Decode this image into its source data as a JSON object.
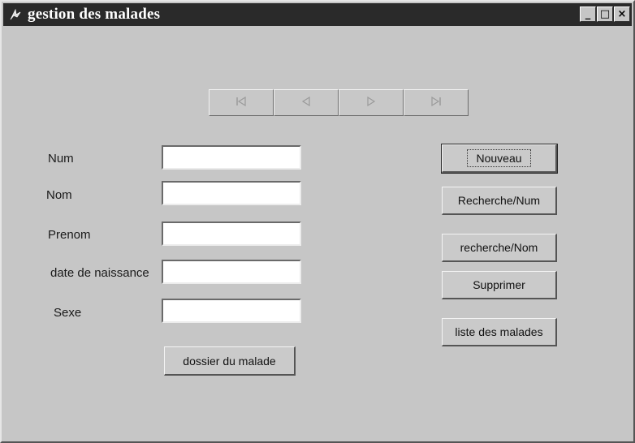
{
  "window": {
    "title": "gestion des malades",
    "minimize_glyph": "_",
    "maximize_glyph": "□",
    "close_glyph": "×"
  },
  "navigation": {
    "first_icon": "first-record-icon",
    "prev_icon": "previous-record-icon",
    "next_icon": "next-record-icon",
    "last_icon": "last-record-icon"
  },
  "form": {
    "num_label": "Num",
    "nom_label": "Nom",
    "prenom_label": "Prenom",
    "date_label": "date de naissance",
    "sexe_label": "Sexe",
    "num_value": "",
    "nom_value": "",
    "prenom_value": "",
    "date_value": "",
    "sexe_value": ""
  },
  "buttons": {
    "nouveau": "Nouveau",
    "recherche_num": "Recherche/Num",
    "recherche_nom": "recherche/Nom",
    "supprimer": "Supprimer",
    "liste": "liste des malades",
    "dossier": "dossier du malade"
  }
}
